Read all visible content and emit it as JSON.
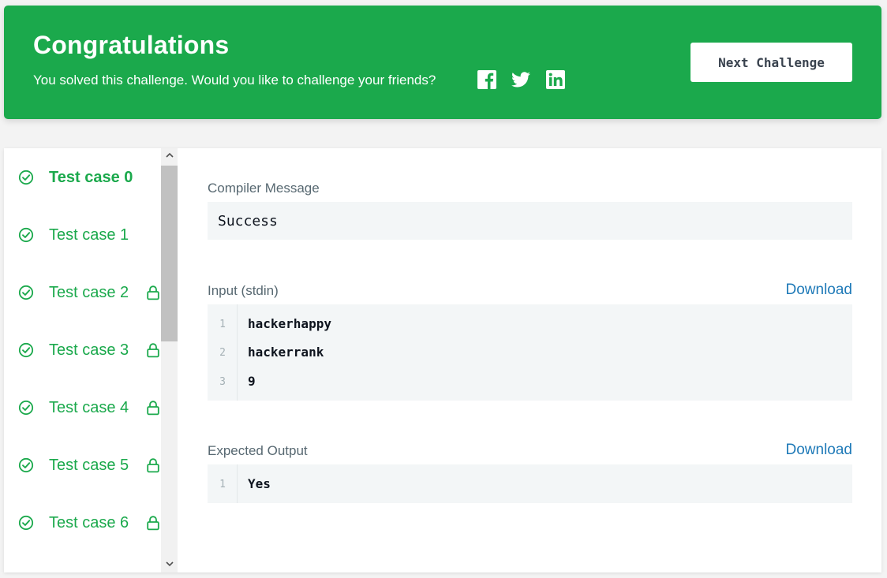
{
  "banner": {
    "title": "Congratulations",
    "subtitle": "You solved this challenge. Would you like to challenge your friends?",
    "next_button": "Next Challenge",
    "bg_color": "#1ba94c",
    "social_icons": [
      "facebook-icon",
      "twitter-icon",
      "linkedin-icon"
    ]
  },
  "test_cases": [
    {
      "label": "Test case 0",
      "status": "passed",
      "locked": false,
      "active": true
    },
    {
      "label": "Test case 1",
      "status": "passed",
      "locked": false,
      "active": false
    },
    {
      "label": "Test case 2",
      "status": "passed",
      "locked": true,
      "active": false
    },
    {
      "label": "Test case 3",
      "status": "passed",
      "locked": true,
      "active": false
    },
    {
      "label": "Test case 4",
      "status": "passed",
      "locked": true,
      "active": false
    },
    {
      "label": "Test case 5",
      "status": "passed",
      "locked": true,
      "active": false
    },
    {
      "label": "Test case 6",
      "status": "passed",
      "locked": true,
      "active": false
    }
  ],
  "compiler": {
    "label": "Compiler Message",
    "message": "Success"
  },
  "input": {
    "label": "Input (stdin)",
    "download": "Download",
    "line_numbers": [
      "1",
      "2",
      "3"
    ],
    "lines": [
      "hackerhappy",
      "hackerrank",
      "9"
    ]
  },
  "expected": {
    "label": "Expected Output",
    "download": "Download",
    "line_numbers": [
      "1"
    ],
    "lines": [
      "Yes"
    ]
  },
  "colors": {
    "success": "#1ba94c",
    "link": "#1f7ab8",
    "muted": "#576871",
    "code_bg": "#f3f6f7"
  }
}
